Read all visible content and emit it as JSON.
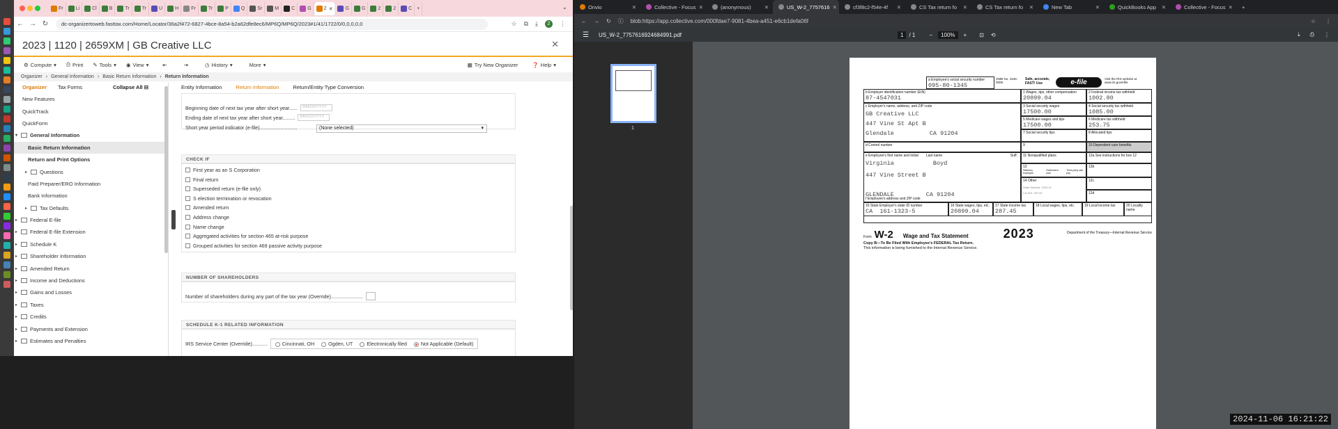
{
  "left_browser": {
    "tab_count_label": "2",
    "url": "dc-organizertoweb.fasttax.com/Home/Locator/36a2f472-6827-4bce-8a54-b2a62dfe8ec6/MP6Q/MP6Q/2023#1/41/1722/0/0,0,0,0,0",
    "tab_labels": [
      "Fr",
      "Li",
      "Cl",
      "B",
      "Tr",
      "Tr",
      "U",
      "H",
      "Fr",
      "Tr",
      "P",
      "Q",
      "Sr",
      "M",
      "C",
      "G",
      "2",
      "G",
      "G",
      "2",
      "2",
      "C"
    ]
  },
  "app": {
    "title": "2023 | 1120 | 2659XM | GB Creative LLC",
    "close_glyph": "✕",
    "menu": [
      "Compute",
      "Print",
      "Tools",
      "View",
      "History",
      "More"
    ],
    "try_organizer": "Try New Organizer",
    "help": "Help",
    "breadcrumb": [
      "Organizer",
      "General Information",
      "Basic Return Information",
      "Return Information"
    ]
  },
  "sidebar": {
    "tab_organizer": "Organizer",
    "tab_forms": "Tax Forms",
    "collapse_all": "Collapse All",
    "items": [
      {
        "label": "New Features",
        "indent": 0,
        "type": "plain"
      },
      {
        "label": "QuickTrack",
        "indent": 0,
        "type": "plain"
      },
      {
        "label": "QuickForm",
        "indent": 0,
        "type": "plain"
      },
      {
        "label": "General Information",
        "indent": 0,
        "type": "folder-open"
      },
      {
        "label": "Basic Return Information",
        "indent": 1,
        "type": "selected"
      },
      {
        "label": "Return and Print Options",
        "indent": 1,
        "type": "bold"
      },
      {
        "label": "Questions",
        "indent": 1,
        "type": "folder"
      },
      {
        "label": "Paid Preparer/ERO Information",
        "indent": 1,
        "type": "plain"
      },
      {
        "label": "Bank Information",
        "indent": 1,
        "type": "plain"
      },
      {
        "label": "Tax Defaults",
        "indent": 1,
        "type": "folder"
      },
      {
        "label": "Federal E-file",
        "indent": 0,
        "type": "folder"
      },
      {
        "label": "Federal E-file Extension",
        "indent": 0,
        "type": "folder"
      },
      {
        "label": "Schedule K",
        "indent": 0,
        "type": "folder"
      },
      {
        "label": "Shareholder Information",
        "indent": 0,
        "type": "folder"
      },
      {
        "label": "Amended Return",
        "indent": 0,
        "type": "folder"
      },
      {
        "label": "Income and Deductions",
        "indent": 0,
        "type": "folder"
      },
      {
        "label": "Gains and Losses",
        "indent": 0,
        "type": "folder"
      },
      {
        "label": "Taxes",
        "indent": 0,
        "type": "folder"
      },
      {
        "label": "Credits",
        "indent": 0,
        "type": "folder"
      },
      {
        "label": "Payments and Extension",
        "indent": 0,
        "type": "folder"
      },
      {
        "label": "Estimates and Penalties",
        "indent": 0,
        "type": "folder"
      }
    ]
  },
  "main": {
    "tabs": [
      "Entity Information",
      "Return Information",
      "Return/Entity Type Conversion"
    ],
    "begin_date_label": "Beginning date of next tax year after short year......",
    "end_date_label": "Ending date of next tax year after short year.........",
    "date_placeholder": "MM/DD/YYYY",
    "short_year_label": "Short year period indicator (e-file)...........................",
    "short_year_value": "(None selected)",
    "check_if_header": "CHECK IF",
    "checkboxes": [
      "First year as an S Corporation",
      "Final return",
      "Superseded return (e-file only)",
      "S election termination or revocation",
      "Amended return",
      "Address change",
      "Name change",
      "Aggregated activities for section 465 at-risk purpose",
      "Grouped activities for section 469 passive activity purpose"
    ],
    "shareholders_header": "NUMBER OF SHAREHOLDERS",
    "shareholders_label": "Number of shareholders during any part of the tax year (Override).......................",
    "k1_header": "SCHEDULE K-1 RELATED INFORMATION",
    "irs_center_label": "IRS Service Center (Override)...........",
    "irs_options": [
      "Cincinnati, OH",
      "Ogden, UT",
      "Electronically filed",
      "Not Applicable (Default)"
    ],
    "irs_selected_index": 3
  },
  "right_browser": {
    "tabs": [
      "Onvio",
      "Collective - Focus",
      "(anonymous)",
      "US_W-2_7757616",
      "cf3f8c2-f54e-4f",
      "CS Tax return fo",
      "CS Tax return fo",
      "New Tab",
      "QuickBooks App",
      "Collective - Focus"
    ],
    "active_tab_index": 3,
    "url": "blob:https://app.collective.com/000fdae7-9081-4bea-a451-e6cb1defa06f",
    "pdf_name": "US_W-2_7757616924684991.pdf",
    "page_current": "1",
    "page_total": "/ 1",
    "zoom": "100%",
    "thumb_page": "1"
  },
  "w2": {
    "ssn_label": "a Employee's social security number",
    "ssn": "095-80-1345",
    "omb": "OMB No. 1545-0008",
    "safe_text": "Safe, accurate, FAST! Use",
    "efile": "e-file",
    "irs_visit": "Visit the IRS website at www.irs.gov/efile",
    "ein_label": "b Employer identification number (EIN)",
    "ein": "87-4547031",
    "box1_label": "1 Wages, tips, other compensation",
    "box1": "20899.04",
    "box2_label": "2 Federal income tax withheld",
    "box2": "1002.80",
    "employer_label": "c Employer's name, address, and ZIP code",
    "employer_name": "GB Creative LLC",
    "employer_addr": "447 Vine St Apt B",
    "employer_city": "Glendale",
    "employer_state_zip": "CA  91204",
    "box3_label": "3 Social security wages",
    "box3": "17500.00",
    "box4_label": "4 Social security tax withheld",
    "box4": "1085.00",
    "box5_label": "5 Medicare wages and tips",
    "box5": "17500.00",
    "box6_label": "6 Medicare tax withheld",
    "box6": "253.75",
    "box7_label": "7 Social security tips",
    "box8_label": "8 Allocated tips",
    "control_label": "d Control number",
    "box9_label": "9",
    "box10_label": "10 Dependent care benefits",
    "emp_name_label": "e Employee's first name and initial",
    "last_name_label": "Last name",
    "suff_label": "Suff.",
    "emp_first": "Virginia",
    "emp_last": "Boyd",
    "emp_addr": "447 Vine Street B",
    "emp_city": "GLENDALE",
    "emp_state_zip": "CA  91204",
    "emp_addr_label": "f Employee's address and ZIP code",
    "box11_label": "11 Nonqualified plans",
    "box12a_label": "12a See instructions for box 12",
    "box13_label": "13",
    "box13_opts": [
      "Statutory employee",
      "Retirement plan",
      "Third-party sick pay"
    ],
    "box14_label": "14 Other",
    "box14_text1": "State Medical: 2344.41",
    "box14_text2": "CA SDI: 257.00",
    "box12b": "12b",
    "box12c": "12c",
    "box12d": "12d",
    "box15_label": "15 State  Employer's state ID number",
    "box15_state": "CA",
    "box15_id": "161-1323-5",
    "box16_label": "16 State wages, tips, etc.",
    "box16": "20899.04",
    "box17_label": "17 State income tax",
    "box17": "287.45",
    "box18_label": "18 Local wages, tips, etc.",
    "box19_label": "19 Local income tax",
    "box20_label": "20 Locality name",
    "form_word": "Form",
    "form_name": "W-2",
    "form_title": "Wage and Tax Statement",
    "year": "2023",
    "dept": "Department of the Treasury—Internal Revenue Service",
    "copy_line": "Copy B—To Be Filed With Employee's FEDERAL Tax Return.",
    "copy_line2": "This information is being furnished to the Internal Revenue Service."
  },
  "system": {
    "timestamp": "2024-11-06 16:21:22"
  },
  "colors": {
    "accent_orange": "#f5a623",
    "left_tab_bg": "#f7d8dc",
    "pdf_bg": "#525659"
  }
}
